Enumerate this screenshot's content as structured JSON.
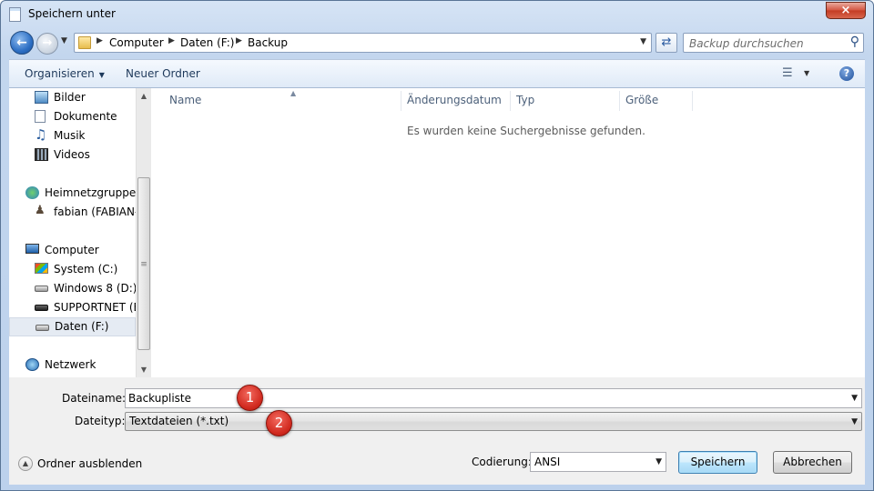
{
  "window": {
    "title": "Speichern unter",
    "close_label": "×"
  },
  "nav": {
    "breadcrumb": [
      "Computer",
      "Daten (F:)",
      "Backup"
    ],
    "search_placeholder": "Backup durchsuchen"
  },
  "toolbar": {
    "organize_label": "Organisieren",
    "new_folder_label": "Neuer Ordner",
    "help_label": "?"
  },
  "sidebar": {
    "items": [
      {
        "label": "Bilder",
        "icon": "pictures-icon"
      },
      {
        "label": "Dokumente",
        "icon": "documents-icon"
      },
      {
        "label": "Musik",
        "icon": "music-icon"
      },
      {
        "label": "Videos",
        "icon": "videos-icon"
      },
      {
        "label": "Heimnetzgruppe",
        "icon": "homegroup-icon"
      },
      {
        "label": "fabian (FABIAN-P",
        "icon": "user-icon"
      },
      {
        "label": "Computer",
        "icon": "computer-icon"
      },
      {
        "label": "System (C:)",
        "icon": "system-drive-icon"
      },
      {
        "label": "Windows 8 (D:)",
        "icon": "drive-icon"
      },
      {
        "label": "SUPPORTNET (E:",
        "icon": "drive-icon"
      },
      {
        "label": "Daten (F:)",
        "icon": "drive-icon",
        "selected": true
      },
      {
        "label": "Netzwerk",
        "icon": "network-icon"
      }
    ]
  },
  "filelist": {
    "columns": [
      "Name",
      "Änderungsdatum",
      "Typ",
      "Größe"
    ],
    "empty_message": "Es wurden keine Suchergebnisse gefunden."
  },
  "save": {
    "filename_label": "Dateiname:",
    "filename_value": "Backupliste",
    "filetype_label": "Dateityp:",
    "filetype_value": "Textdateien (*.txt)",
    "hide_folders_label": "Ordner ausblenden",
    "encoding_label": "Codierung:",
    "encoding_value": "ANSI",
    "save_button": "Speichern",
    "cancel_button": "Abbrechen"
  },
  "badges": [
    "1",
    "2"
  ],
  "colors": {
    "badge": "#d12a1f",
    "accent": "#3c7fb1",
    "selection": "#e5ebf3"
  }
}
